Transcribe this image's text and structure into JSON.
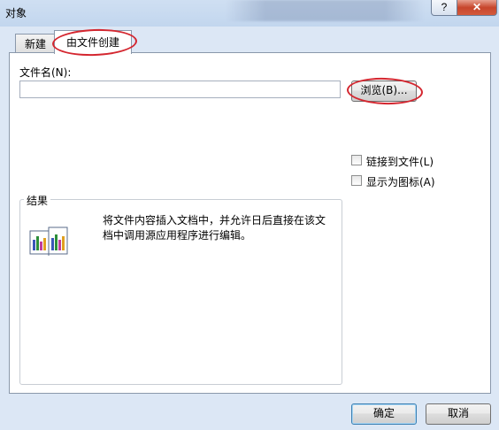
{
  "window": {
    "title": "对象",
    "help_glyph": "?",
    "close_glyph": "✕"
  },
  "tabs": {
    "new_label": "新建",
    "from_file_label": "由文件创建",
    "active": "from_file"
  },
  "file": {
    "label": "文件名(N):",
    "value": "",
    "browse_label": "浏览(B)..."
  },
  "options": {
    "link_label": "链接到文件(L)",
    "link_checked": false,
    "icon_label": "显示为图标(A)",
    "icon_checked": false
  },
  "result": {
    "title": "结果",
    "description": "将文件内容插入文档中，并允许日后直接在该文档中调用源应用程序进行编辑。",
    "icon": "embedded-document-icon"
  },
  "footer": {
    "ok_label": "确定",
    "cancel_label": "取消"
  },
  "colors": {
    "annotation": "#d4262f",
    "close_button": "#c7462c"
  }
}
